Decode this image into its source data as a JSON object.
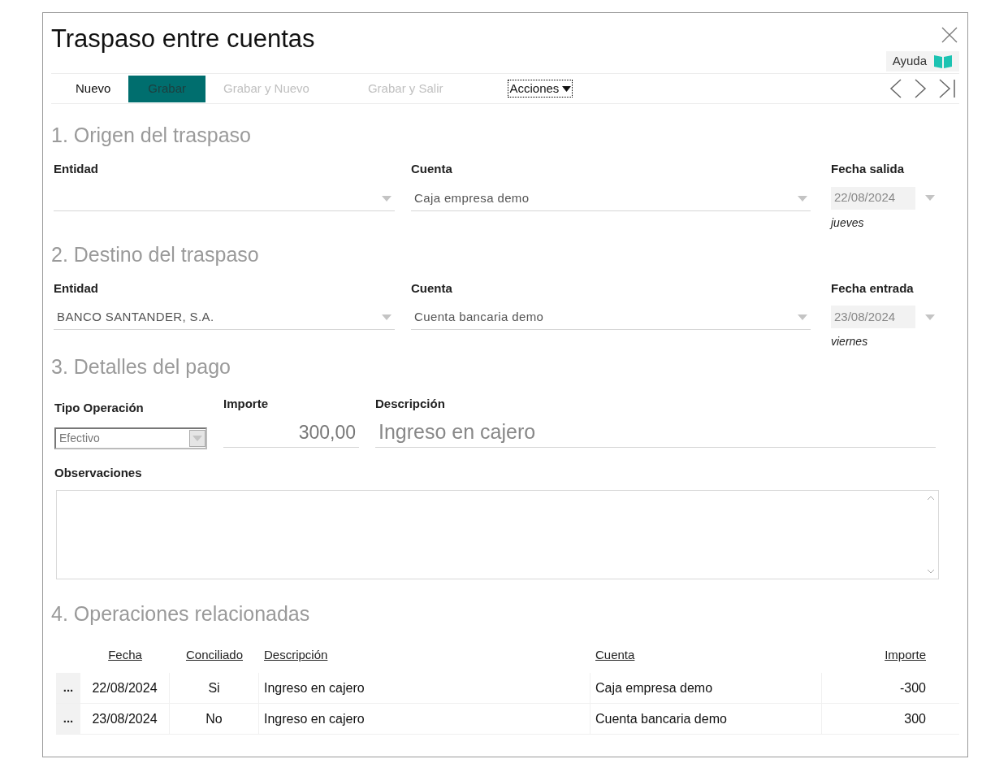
{
  "window": {
    "title": "Traspaso entre cuentas",
    "help": "Ayuda"
  },
  "toolbar": [
    {
      "label": "Nuevo",
      "kind": "plain",
      "disabled": false
    },
    {
      "label": "Grabar",
      "kind": "primary",
      "disabled": true
    },
    {
      "label": "Grabar y Nuevo",
      "kind": "plain",
      "disabled": true
    },
    {
      "label": "Grabar y Salir",
      "kind": "plain",
      "disabled": true
    },
    {
      "label": "Acciones",
      "kind": "menu",
      "disabled": false
    }
  ],
  "origin": {
    "heading": "1. Origen del traspaso",
    "entity_label": "Entidad",
    "account_label": "Cuenta",
    "account": "Caja empresa demo",
    "date_label": "Fecha salida",
    "date": "22/08/2024",
    "weekday": "jueves"
  },
  "destination": {
    "heading": "2. Destino del traspaso",
    "entity_label": "Entidad",
    "entity": "BANCO SANTANDER, S.A.",
    "account_label": "Cuenta",
    "account": "Cuenta bancaria demo",
    "date_label": "Fecha entrada",
    "date": "23/08/2024",
    "weekday": "viernes"
  },
  "payment": {
    "heading": "3. Detalles del pago",
    "type_label": "Tipo Operación",
    "type": "Efectivo",
    "amount_label": "Importe",
    "amount": "300,00",
    "description_label": "Descripción",
    "description": "Ingreso en cajero",
    "notes_label": "Observaciones"
  },
  "related": {
    "heading": "4. Operaciones relacionadas",
    "columns": [
      "Fecha",
      "Conciliado",
      "Descripción",
      "Cuenta",
      "Importe"
    ],
    "rows": [
      {
        "menu": "...",
        "cells": [
          "22/08/2024",
          "Si",
          "Ingreso en cajero",
          "Caja empresa demo",
          "-300"
        ]
      },
      {
        "menu": "...",
        "cells": [
          "23/08/2024",
          "No",
          "Ingreso en cajero",
          "Cuenta bancaria demo",
          "300"
        ]
      }
    ]
  }
}
